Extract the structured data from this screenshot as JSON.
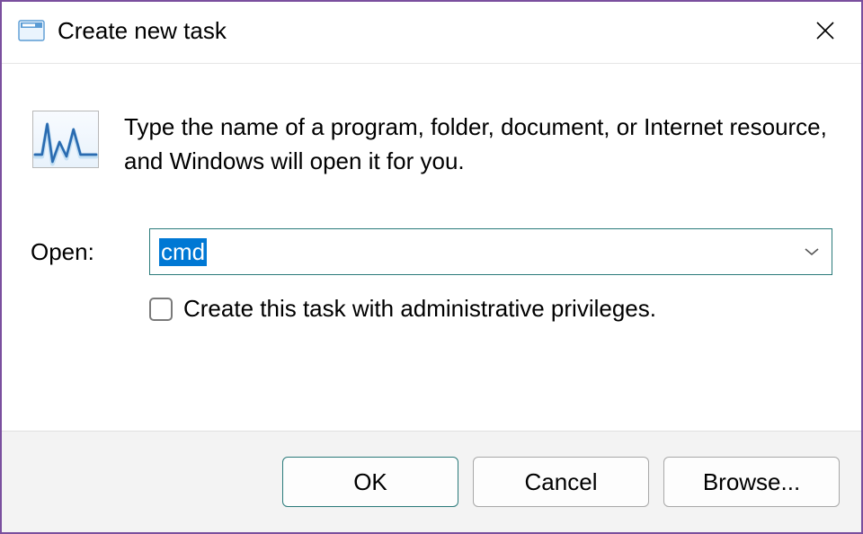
{
  "titlebar": {
    "title": "Create new task"
  },
  "content": {
    "description": "Type the name of a program, folder, document, or Internet resource, and Windows will open it for you.",
    "open_label": "Open:",
    "open_value": "cmd",
    "admin_checkbox_label": "Create this task with administrative privileges.",
    "admin_checked": false
  },
  "buttons": {
    "ok": "OK",
    "cancel": "Cancel",
    "browse": "Browse..."
  }
}
